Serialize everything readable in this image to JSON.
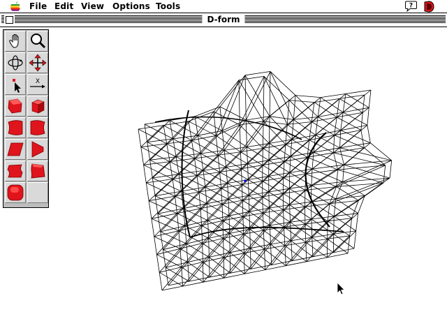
{
  "menubar": {
    "items": [
      "File",
      "Edit",
      "View",
      "Options",
      "Tools"
    ]
  },
  "window": {
    "title": "D-form"
  },
  "palette": {
    "tools": [
      {
        "name": "hand-tool",
        "icon": "hand-icon"
      },
      {
        "name": "zoom-tool",
        "icon": "magnifier-icon"
      },
      {
        "name": "rotate-tool",
        "icon": "orbit-rotate-icon"
      },
      {
        "name": "move-tool",
        "icon": "four-arrow-move-icon"
      },
      {
        "name": "select-tool",
        "icon": "arrow-pointer-icon"
      },
      {
        "name": "axis-tool",
        "icon": "x-axis-icon",
        "label": "X"
      },
      {
        "name": "shape-a-tool",
        "icon": "red-polygon-icon"
      },
      {
        "name": "shape-b-tool",
        "icon": "red-cube-icon"
      },
      {
        "name": "warp-left-tool",
        "icon": "red-warp-left-icon"
      },
      {
        "name": "warp-right-tool",
        "icon": "red-warp-right-icon"
      },
      {
        "name": "skew-tool",
        "icon": "red-skew-icon"
      },
      {
        "name": "taper-tool",
        "icon": "red-taper-icon"
      },
      {
        "name": "bend-tool",
        "icon": "red-bend-icon"
      },
      {
        "name": "twist-tool",
        "icon": "red-twist-icon"
      },
      {
        "name": "sphere-tool",
        "icon": "red-rounded-square-icon"
      },
      {
        "name": "empty-tool-slot",
        "icon": ""
      }
    ]
  },
  "colors": {
    "accent_red": "#e0141c",
    "palette_bg": "#bdbdbd",
    "wire": "#000000",
    "center_point": "#0000ff"
  }
}
